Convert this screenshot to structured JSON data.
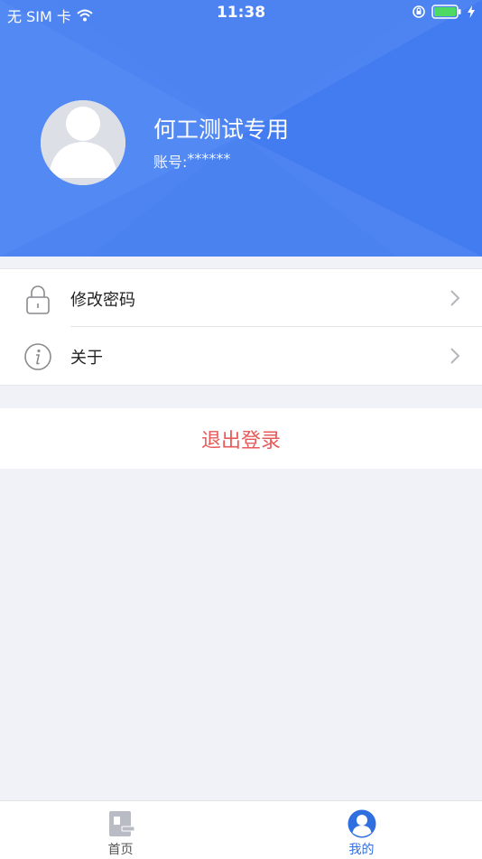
{
  "status_bar": {
    "carrier": "无 SIM 卡",
    "time": "11:38"
  },
  "profile": {
    "name": "何工测试专用",
    "account_label": "账号:",
    "account_value": "******"
  },
  "menu": {
    "items": [
      {
        "label": "修改密码",
        "icon": "lock-icon"
      },
      {
        "label": "关于",
        "icon": "info-icon"
      }
    ]
  },
  "logout": {
    "label": "退出登录"
  },
  "tabbar": {
    "tabs": [
      {
        "label": "首页",
        "icon": "home-icon",
        "active": false
      },
      {
        "label": "我的",
        "icon": "user-icon",
        "active": true
      }
    ]
  },
  "colors": {
    "header_blue": "#4d84f1",
    "accent_blue": "#2f6fe0",
    "logout_red": "#e85a5a",
    "page_bg": "#f1f2f7"
  }
}
